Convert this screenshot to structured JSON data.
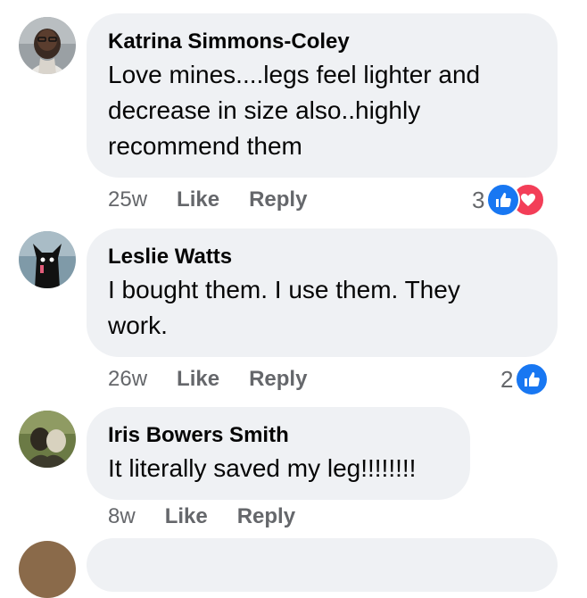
{
  "comments": [
    {
      "author": "Katrina Simmons-Coley",
      "text": "Love mines....legs feel lighter and decrease in size also..highly recommend them",
      "time": "25w",
      "like_label": "Like",
      "reply_label": "Reply",
      "reaction_count": "3",
      "reactions": [
        "like-icon",
        "love-icon"
      ]
    },
    {
      "author": "Leslie Watts",
      "text": "I bought them. I use them. They work.",
      "time": "26w",
      "like_label": "Like",
      "reply_label": "Reply",
      "reaction_count": "2",
      "reactions": [
        "like-icon"
      ]
    },
    {
      "author": "Iris Bowers Smith",
      "text": "It literally saved my leg!!!!!!!!",
      "time": "8w",
      "like_label": "Like",
      "reply_label": "Reply"
    }
  ],
  "colors": {
    "bubble": "#eff1f4",
    "meta_text": "#65676b",
    "like_blue": "#1877f2",
    "love_red": "#f33e58"
  }
}
